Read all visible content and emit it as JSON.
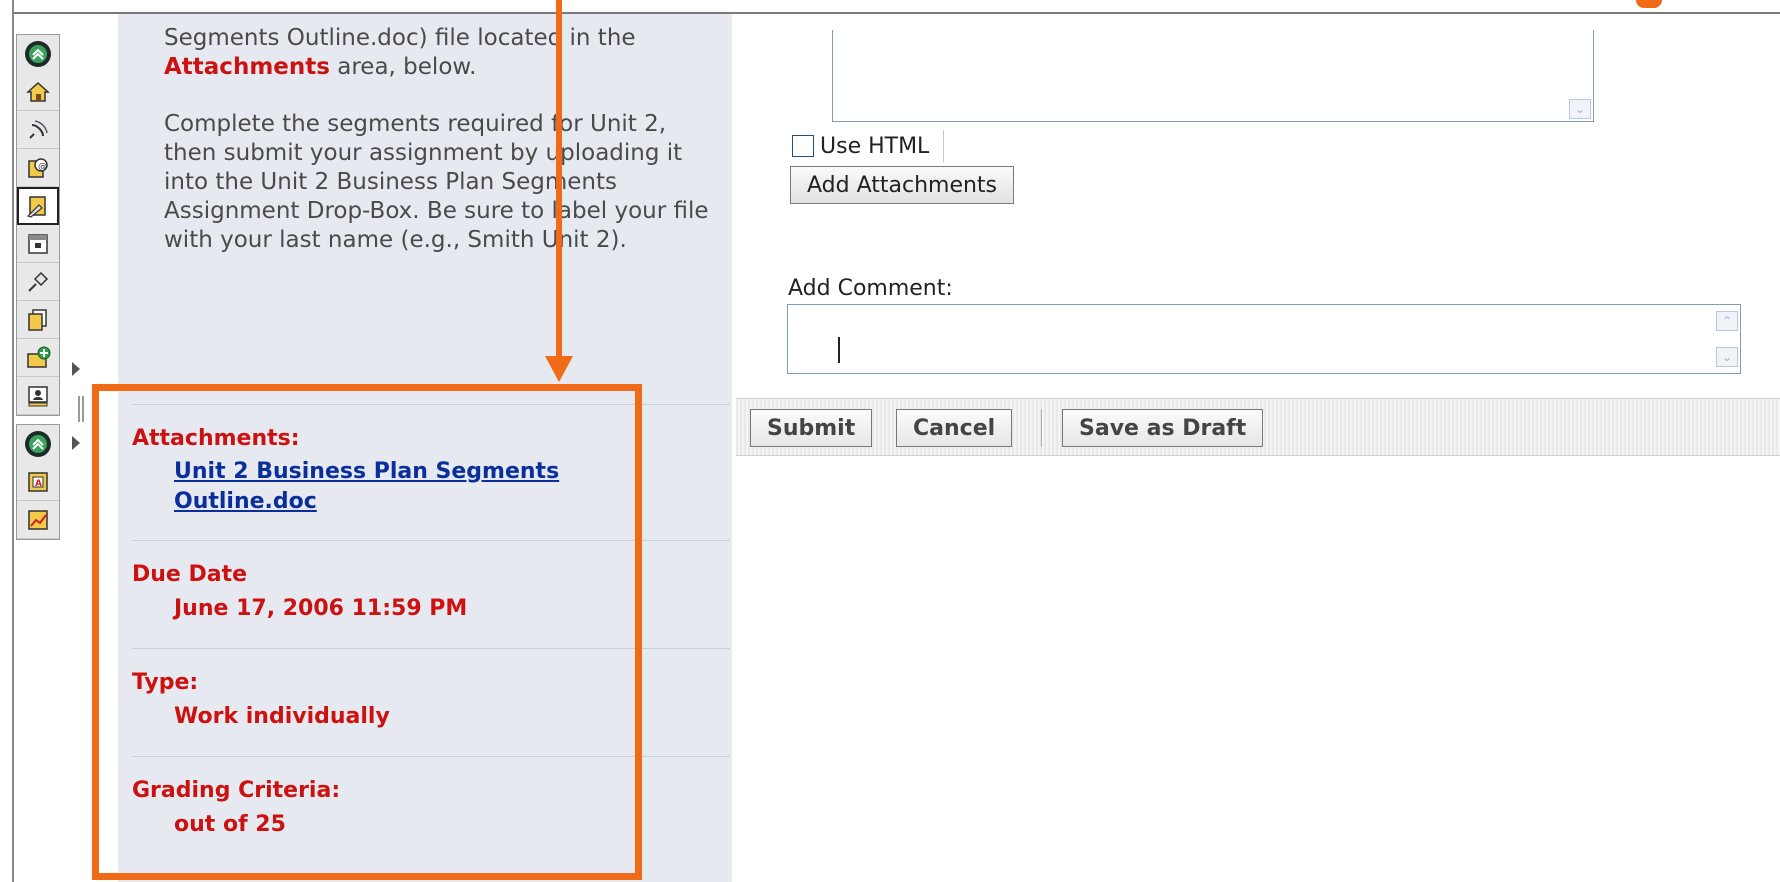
{
  "description": {
    "line1": "Segments Outline.doc) file located in the",
    "attachments_word": "Attachments",
    "line2_rest": " area, below.",
    "paragraph2": "Complete the segments required for Unit 2, then submit your assignment by uploading it into the Unit 2 Business Plan Segments Assignment Drop-Box. Be sure to label your file with your last name (e.g., Smith Unit 2)."
  },
  "details": {
    "attachments_label": "Attachments:",
    "attachment_link": "Unit 2 Business Plan Segments Outline.doc",
    "due_date_label": "Due Date",
    "due_date_value": "June 17, 2006 11:59 PM",
    "type_label": "Type:",
    "type_value": "Work individually",
    "grading_label": "Grading Criteria:",
    "grading_value": "out of 25"
  },
  "form": {
    "use_html_label": "Use HTML",
    "use_html_checked": false,
    "add_attachments_label": "Add Attachments",
    "add_comment_label": "Add Comment:",
    "comment_value": ""
  },
  "actions": {
    "submit_label": "Submit",
    "cancel_label": "Cancel",
    "save_draft_label": "Save as Draft"
  },
  "toolbar": {
    "group1": [
      "collapse-up-icon",
      "home-icon",
      "announcement-icon",
      "discussion-icon",
      "assignment-icon",
      "calendar-icon",
      "pin-icon",
      "documents-icon",
      "add-message-icon",
      "presentation-icon"
    ],
    "group2": [
      "collapse-up-icon",
      "grades-icon",
      "reports-icon"
    ]
  },
  "colors": {
    "highlight": "#f06a17",
    "label_red": "#cc1111",
    "link_blue": "#0a2f9a",
    "panel_bg": "#e6eaf0"
  }
}
